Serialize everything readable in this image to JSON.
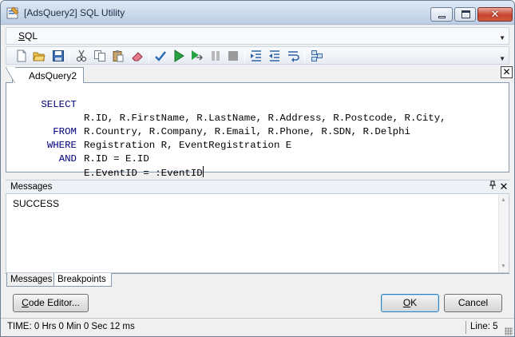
{
  "window": {
    "title": "[AdsQuery2] SQL Utility",
    "close_glyph": "✕"
  },
  "menu": {
    "items": [
      {
        "accel": "S",
        "rest": "QL"
      }
    ]
  },
  "toolbar": {
    "icons": [
      "new-icon",
      "open-icon",
      "save-icon",
      "cut-icon",
      "copy-icon",
      "paste-icon",
      "erase-icon",
      "verify-icon",
      "run-icon",
      "step-icon",
      "pause-icon",
      "stop-icon",
      "indent-icon",
      "outdent-icon",
      "wrap-icon",
      "layout-icon"
    ]
  },
  "tabs": {
    "document": "AdsQuery2",
    "close_glyph": "✕"
  },
  "editor": {
    "lines": [
      {
        "keyword": "SELECT",
        "code": "R.ID, R.FirstName, R.LastName, R.Address, R.Postcode, R.City,"
      },
      {
        "keyword": "",
        "code": "R.Country, R.Company, R.Email, R.Phone, R.SDN, R.Delphi"
      },
      {
        "keyword": "FROM",
        "code": "Registration R, EventRegistration E"
      },
      {
        "keyword": "WHERE",
        "code": "R.ID = E.ID"
      },
      {
        "keyword": "AND",
        "code": "E.EventID = :EventID"
      }
    ]
  },
  "messages": {
    "title": "Messages",
    "pin_glyph": "🖈",
    "close_glyph": "✕",
    "text": "SUCCESS"
  },
  "panel_tabs": {
    "messages": "Messages",
    "breakpoints": "Breakpoints"
  },
  "buttons": {
    "code_editor": {
      "accel": "C",
      "rest": "ode Editor..."
    },
    "ok": {
      "accel": "O",
      "rest": "K"
    },
    "cancel": "Cancel"
  },
  "status": {
    "time": "TIME: 0 Hrs  0 Min  0 Sec  12 ms",
    "line": "Line: 5"
  },
  "colors": {
    "keyword": "#00007f",
    "ok_border": "#3c7fb1"
  }
}
